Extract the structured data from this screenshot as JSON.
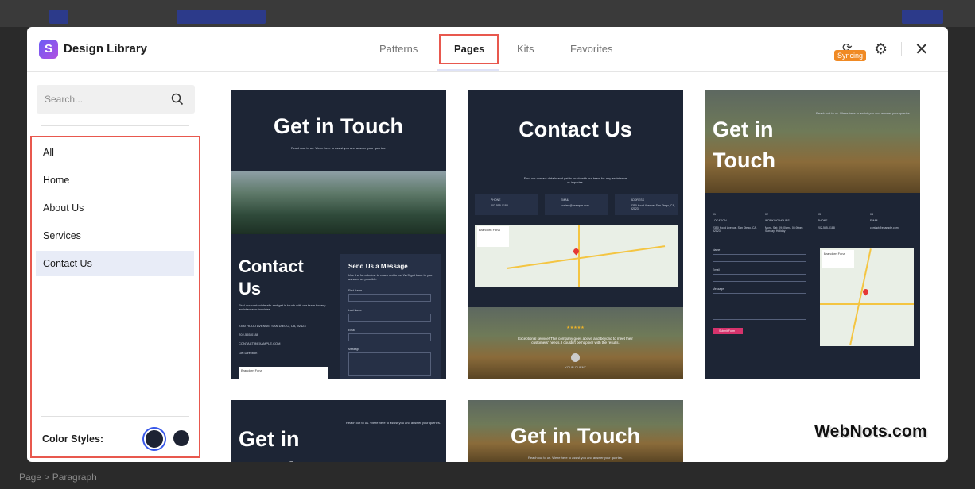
{
  "app": {
    "title": "Design Library",
    "logo_letter": "S"
  },
  "tabs": [
    {
      "label": "Patterns"
    },
    {
      "label": "Pages"
    },
    {
      "label": "Kits"
    },
    {
      "label": "Favorites"
    }
  ],
  "header": {
    "sync_badge": "Syncing",
    "settings_icon": "gear-icon",
    "close_icon": "close-icon"
  },
  "sidebar": {
    "search_placeholder": "Search...",
    "categories": [
      {
        "label": "All"
      },
      {
        "label": "Home"
      },
      {
        "label": "About Us"
      },
      {
        "label": "Services"
      },
      {
        "label": "Contact Us"
      }
    ],
    "color_styles_label": "Color Styles:",
    "swatch_colors": [
      "#1d2333",
      "#1d2333"
    ]
  },
  "cards": {
    "c1": {
      "title": "Get in Touch",
      "subtitle": "Reach out to us. We're here to assist you and answer your queries.",
      "contact_title": "Contact Us",
      "contact_text": "Find our contact details and get in touch with our team for any assistance or inquiries.",
      "address": "2350 HOOD AVENUE, SAN DIEGO, CA, 92123",
      "phone": "202-555-0188",
      "email": "CONTACT@EXAMPLE.COM",
      "directions": "Get Direction",
      "form_title": "Send Us a Message",
      "form_text": "Use the form below to reach out to us. We'll get back to you as soon as possible.",
      "first_name": "First Name",
      "last_name": "Last Name",
      "email_label": "Email",
      "message": "Message",
      "map_place": "Brandorn Fona"
    },
    "c2": {
      "title": "Contact Us",
      "subtitle": "Find our contact details and get in touch with our team for any assistance or inquiries.",
      "phone_label": "PHONE",
      "phone": "202-555-0188",
      "email_label": "EMAIL",
      "email": "contact@example.com",
      "address_label": "ADDRESS",
      "address": "2350 Hood Avenue, San Diego, CA, 92123",
      "map_place": "Brandorn Fona",
      "stars": "★★★★★",
      "quote": "Exceptional service! This company goes above and beyond to meet their customers' needs. I couldn't be happier with the results.",
      "client": "YOUR CLIENT"
    },
    "c3": {
      "title": "Get in Touch",
      "subtitle": "Reach out to us. We're here to assist you and answer your queries.",
      "n1": "01",
      "l1": "LOCATION",
      "v1": "2350 Hood Avenue, San Diego, CA, 92123",
      "n2": "02",
      "l2": "WORKING HOURS",
      "v2": "Mon - Sat: 09:00am - 05:00pm Sunday: Holiday",
      "n3": "03",
      "l3": "PHONE",
      "v3": "202-555-0188",
      "n4": "04",
      "l4": "EMAIL",
      "v4": "contact@example.com",
      "name": "Name",
      "email_label": "Email",
      "message": "Message",
      "submit": "Submit Form",
      "map_place": "Brandorn Fona"
    },
    "c4": {
      "title": "Get in Touch",
      "subtitle": "Reach out to us. We're here to assist you and answer your queries."
    },
    "c5": {
      "title": "Get in Touch",
      "subtitle": "Reach out to us. We're here to assist you and answer your queries."
    }
  },
  "watermark": "WebNots.com",
  "background": {
    "breadcrumb": "Page  >  Paragraph"
  }
}
